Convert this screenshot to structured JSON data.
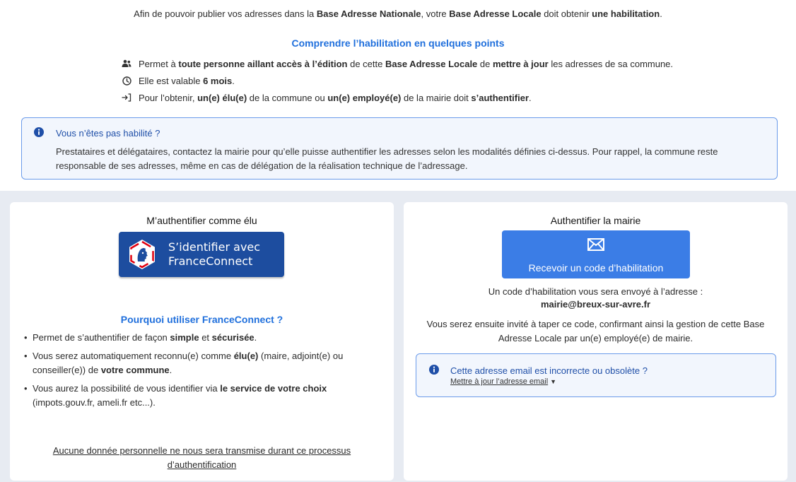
{
  "intro": {
    "p1": "Afin de pouvoir publier vos adresses dans la ",
    "b1": "Base Adresse Nationale",
    "p2": ", votre ",
    "b2": "Base Adresse Locale",
    "p3": " doit obtenir ",
    "b3": "une habilitation",
    "p4": "."
  },
  "learn": {
    "title": "Comprendre l’habilitation en quelques points",
    "point1": {
      "t1": "Permet à ",
      "b1": "toute personne aillant accès à l’édition",
      "t2": " de cette ",
      "b2": "Base Adresse Locale",
      "t3": " de ",
      "b3": "mettre à jour",
      "t4": " les adresses de sa commune."
    },
    "point2": {
      "t1": "Elle est valable ",
      "b1": "6 mois",
      "t2": "."
    },
    "point3": {
      "t1": "Pour l’obtenir, ",
      "b1": "un(e) élu(e)",
      "t2": " de la commune ou ",
      "b2": "un(e) employé(e)",
      "t3": " de la mairie doit ",
      "b3": "s’authentifier",
      "t4": "."
    }
  },
  "info": {
    "title": "Vous n’êtes pas habilité ?",
    "text": "Prestataires et délégataires, contactez la mairie pour qu’elle puisse authentifier les adresses selon les modalités définies ci-dessus. Pour rappel, la commune reste responsable de ses adresses, même en cas de délégation de la réalisation technique de l’adressage."
  },
  "elu": {
    "title": "M’authentifier comme élu",
    "fc_line1": "S’identifier avec",
    "fc_line2": "FranceConnect",
    "why_title": "Pourquoi utiliser FranceConnect ?",
    "item1": {
      "t1": "Permet de s’authentifier de façon ",
      "b1": "simple",
      "t2": " et ",
      "b2": "sécurisée",
      "t3": "."
    },
    "item2": {
      "t1": "Vous serez automatiquement reconnu(e) comme ",
      "b1": "élu(e)",
      "t2": " (maire, adjoint(e) ou conseiller(e)) de ",
      "b2": "votre commune",
      "t3": "."
    },
    "item3": {
      "t1": "Vous aurez la possibilité de vous identifier via ",
      "b1": "le service de votre choix",
      "t2": " (impots.gouv.fr, ameli.fr etc...)."
    },
    "no_data": "Aucune donnée personnelle ne nous sera transmise durant ce processus d’authentification"
  },
  "mairie": {
    "title": "Authentifier la mairie",
    "button_label": "Recevoir un code d’habilitation",
    "sent_to": "Un code d’habilitation vous sera envoyé à l’adresse :",
    "email": "mairie@breux-sur-avre.fr",
    "invite": "Vous serez ensuite invité à taper ce code, confirmant ainsi la gestion de cette Base Adresse Locale par un(e) employé(e) de mairie.",
    "email_box_title": "Cette adresse email est incorrecte ou obsolète ?",
    "email_box_link": "Mettre à jour l’adresse email"
  },
  "colors": {
    "accent": "#1f6fdc",
    "button": "#3b7de6",
    "franceconnect": "#1d4d9f",
    "info_border": "#6b9bea",
    "info_bg": "#f2f6fd",
    "page_grey": "#e7ebf2"
  },
  "icons": {
    "point1": "users-icon",
    "point2": "clock-icon",
    "point3": "sign-in-icon",
    "info": "info-circle-icon",
    "mail": "envelope-icon",
    "dropdown": "caret-down-icon"
  }
}
